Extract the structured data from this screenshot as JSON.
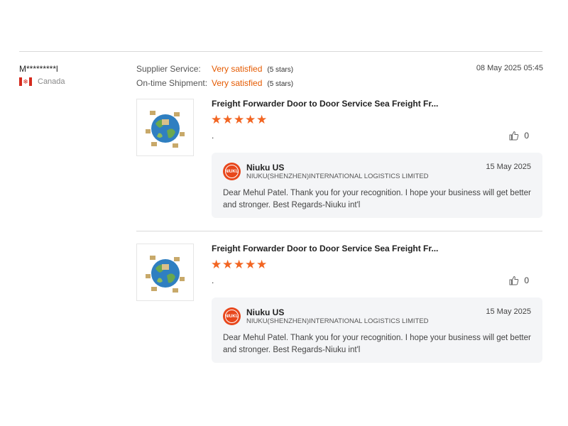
{
  "reviewer": {
    "name": "M*********l",
    "country": "Canada"
  },
  "ratings": [
    {
      "label": "Supplier Service:",
      "value": "Very satisfied",
      "stars": "(5 stars)"
    },
    {
      "label": "On-time Shipment:",
      "value": "Very satisfied",
      "stars": "(5 stars)"
    }
  ],
  "review_date": "08 May 2025 05:45",
  "colors": {
    "accent": "#e55a00",
    "star": "#f26522",
    "reply_bg": "#f4f5f7",
    "logo": "#e8471c"
  },
  "entries": [
    {
      "product_title": "Freight Forwarder Door to Door Service Sea Freight Fr...",
      "star_rating": 5,
      "comment": ".",
      "likes": "0",
      "reply": {
        "logo_text": "NIUKU",
        "name": "Niuku US",
        "company": "NIUKU(SHENZHEN)INTERNATIONAL LOGISTICS LIMITED",
        "date": "15 May 2025",
        "text": "Dear Mehul Patel. Thank you for your recognition. I hope your business will get better and stronger. Best Regards-Niuku int'l"
      }
    },
    {
      "product_title": "Freight Forwarder Door to Door Service Sea Freight Fr...",
      "star_rating": 5,
      "comment": ".",
      "likes": "0",
      "reply": {
        "logo_text": "NIUKU",
        "name": "Niuku US",
        "company": "NIUKU(SHENZHEN)INTERNATIONAL LOGISTICS LIMITED",
        "date": "15 May 2025",
        "text": "Dear Mehul Patel. Thank you for your recognition. I hope your business will get better and stronger. Best Regards-Niuku int'l"
      }
    }
  ],
  "icons": {
    "flag": "canada-flag-icon",
    "star": "star-icon",
    "like": "thumbs-up-icon",
    "logo": "niuku-logo-icon",
    "product": "globe-with-boxes-icon"
  }
}
